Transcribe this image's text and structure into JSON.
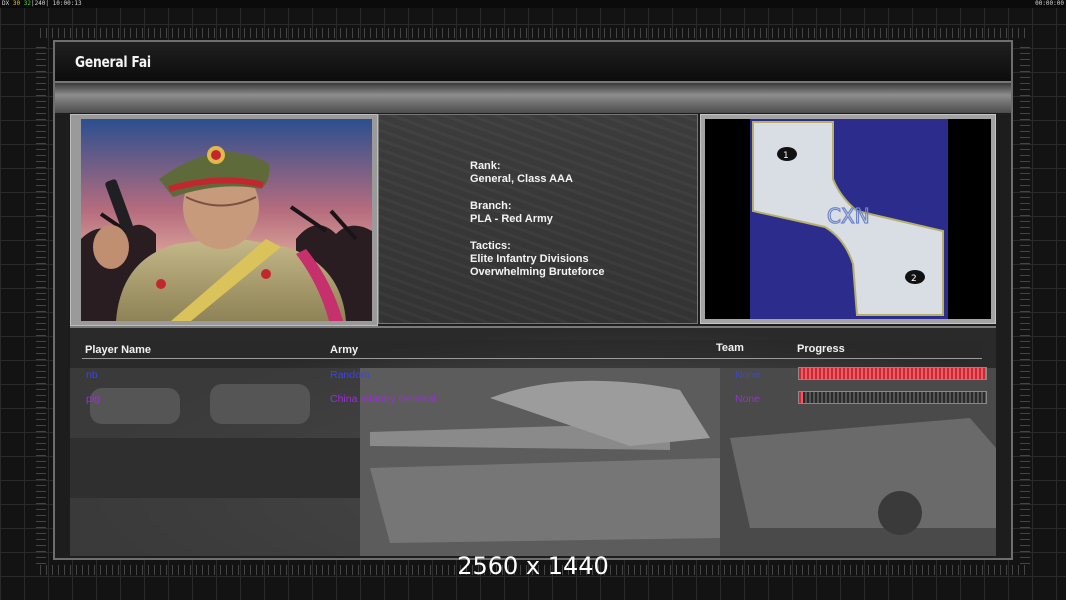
{
  "hud": {
    "left_text": "DX",
    "fps_a": "30",
    "fps_b": "32",
    "fps_sep": "|",
    "fps_c": "240",
    "clock": "10:00:13",
    "right_clock": "00:00:00"
  },
  "general": {
    "name": "General Fai",
    "rank_label": "Rank:",
    "rank_value": "General, Class AAA",
    "branch_label": "Branch:",
    "branch_value": "PLA - Red Army",
    "tactics_label": "Tactics:",
    "tactics_lines": [
      "Elite Infantry Divisions",
      "Overwhelming Bruteforce"
    ]
  },
  "map": {
    "logo_text": "CXN",
    "start_positions": [
      "1",
      "2"
    ],
    "colors": {
      "water": "#2c2c8c",
      "land": "#d9dde4"
    }
  },
  "lobby": {
    "columns": {
      "player": "Player Name",
      "army": "Army",
      "team": "Team",
      "progress": "Progress"
    },
    "players": [
      {
        "name": "nb",
        "army": "Random",
        "team": "None",
        "progress": 1.0,
        "color": "#3b45e0"
      },
      {
        "name": "pig",
        "army": "China Infantry General",
        "team": "None",
        "progress": 0.02,
        "color": "#9a2fd6"
      }
    ]
  },
  "watermark": "2560 x 1440"
}
